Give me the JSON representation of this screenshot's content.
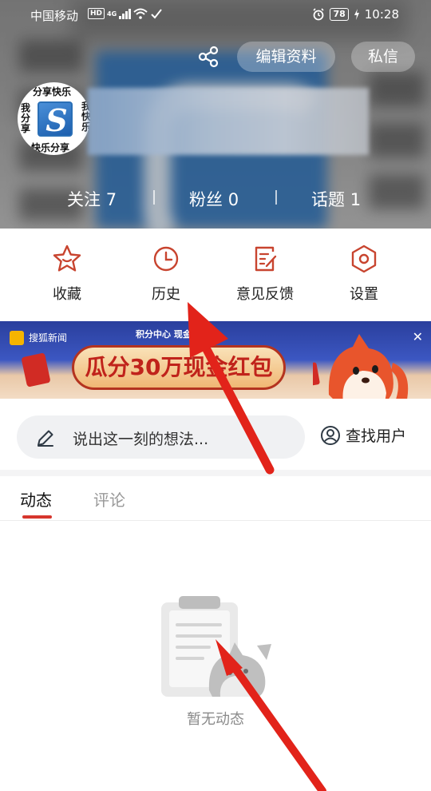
{
  "status_bar": {
    "carrier": "中国移动",
    "hd": "HD",
    "network": "4G",
    "battery": "78",
    "time": "10:28"
  },
  "header": {
    "edit_profile_label": "编辑资料",
    "message_label": "私信",
    "avatar_text": {
      "top": "分享快乐",
      "bottom": "快乐分享",
      "left": "我分享",
      "right": "我快乐"
    },
    "stats": [
      {
        "label": "关注",
        "value": "7"
      },
      {
        "label": "粉丝",
        "value": "0"
      },
      {
        "label": "话题",
        "value": "1"
      }
    ]
  },
  "menu": {
    "items": [
      {
        "label": "收藏",
        "icon": "star-icon"
      },
      {
        "label": "历史",
        "icon": "clock-icon"
      },
      {
        "label": "意见反馈",
        "icon": "feedback-icon"
      },
      {
        "label": "设置",
        "icon": "settings-icon"
      }
    ]
  },
  "banner": {
    "app_name": "搜狐新闻",
    "subtitle": "积分中心 现金",
    "headline": "瓜分30万现金红包"
  },
  "search": {
    "placeholder": "说出这一刻的想法...",
    "find_user_label": "查找用户"
  },
  "tabs": [
    {
      "label": "动态",
      "active": true
    },
    {
      "label": "评论",
      "active": false
    }
  ],
  "empty_state": {
    "text": "暂无动态"
  },
  "colors": {
    "accent": "#d6362d",
    "menu_icon": "#c8442f",
    "arrow": "#e2231a"
  }
}
